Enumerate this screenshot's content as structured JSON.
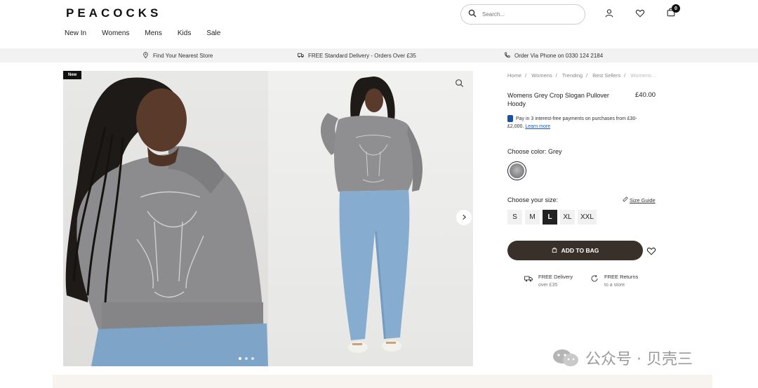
{
  "brand": {
    "logo": "PEACOCKS"
  },
  "nav": [
    "New In",
    "Womens",
    "Mens",
    "Kids",
    "Sale"
  ],
  "search": {
    "placeholder": "Search..."
  },
  "cart": {
    "count": "0"
  },
  "infobar": {
    "store": "Find Your Nearest Store",
    "delivery": "FREE Standard Delivery - Orders Over £35",
    "phone": "Order Via Phone on 0330 124 2184"
  },
  "gallery": {
    "badge": "New",
    "dots": 3
  },
  "breadcrumbs": [
    "Home",
    "Womens",
    "Trending",
    "Best Sellers",
    "Womens..."
  ],
  "product": {
    "title": "Womens Grey Crop Slogan Pullover Hoody",
    "price": "£40.00",
    "paypal_text": "Pay in 3 interest-free payments on purchases from £30-£2,000.",
    "paypal_link": "Learn more",
    "color_label": "Choose color: Grey",
    "size_label": "Choose your size:",
    "size_guide": "Size Guide",
    "sizes": [
      "S",
      "M",
      "L",
      "XL",
      "XXL"
    ],
    "selected_size": "L",
    "add_to_bag": "ADD TO BAG",
    "perks": [
      {
        "title": "FREE Delivery",
        "sub": "over £35"
      },
      {
        "title": "FREE Returns",
        "sub": "to a store"
      }
    ]
  },
  "watermark": "公众号 · 贝壳三"
}
